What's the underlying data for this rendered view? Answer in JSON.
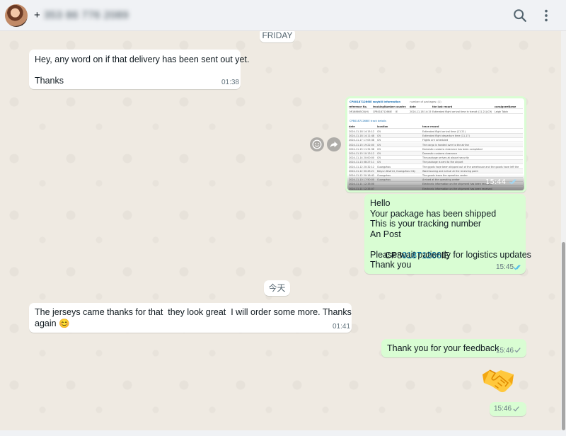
{
  "header": {
    "contact_prefix": "+",
    "contact_number": "353 86 776 2089",
    "search_icon": "search-icon",
    "menu_icon": "more-vertical-icon"
  },
  "messages": [
    {
      "kind": "date",
      "text": "FRIDAY"
    },
    {
      "kind": "incoming",
      "lines": [
        "Hey, any word on if that delivery has been sent out yet.",
        "",
        "Thanks"
      ],
      "time": "01:38"
    },
    {
      "kind": "outgoing-image",
      "time": "15:44",
      "image_text": {
        "title": "CP801871266IE waybill information",
        "count_label": "number of packages: (1)",
        "headers": [
          "reference No.",
          "trackingNumber",
          "country",
          "date",
          "the last record",
          "consigneeName"
        ],
        "row": [
          "OR168665CN(H)",
          "CP801871266IE",
          "IE",
          "2024-11-18 14:15",
          "Estimated flight arrival time in transit (11.21)(C9)",
          "Leigh Tobin"
        ],
        "section": "CP801871266IE track details",
        "track_headers": [
          "date",
          "location",
          "trace record"
        ],
        "track_rows": [
          [
            "2024-11-18 14:15:12",
            "CN",
            "Estimated flight arrival time (11.21)"
          ],
          [
            "2024-11-18 14:11:48",
            "CN",
            "Estimated flight departure time (11.17)"
          ],
          [
            "2024-11-17 17:05:38",
            "CN",
            "Flights are scheduled"
          ],
          [
            "2024-11-15 19:22:00",
            "CN",
            "The cargo is handed over to the airline"
          ],
          [
            "2024-11-15 11:31:38",
            "CN",
            "Domestic customs clearance has been completed"
          ],
          [
            "2024-11-15 10:13:12",
            "CN",
            "Domestic customs clearance"
          ],
          [
            "2024-11-14 20:00:00",
            "CN",
            "The package arrives at airport security"
          ],
          [
            "2024-11-13 08:27:11",
            "CN",
            "The package is sent to the airport"
          ],
          [
            "2024-11-12 20:32:12",
            "Guangzhou",
            "The goods have been shipped out of the warehouse and the goods have left the operation center"
          ],
          [
            "2024-11-12 00:43:21",
            "Baiyun District, Guangzhou City",
            "Warehousing and arrival at the receiving point"
          ],
          [
            "2024-11-12 20:16:42",
            "Guangzhou",
            "The goods leave the operation center"
          ],
          [
            "2024-11-10 17:50:00",
            "Guangzhou",
            "Arrived at the operating center"
          ],
          [
            "2024-11-11 12:33:00",
            "",
            "Electronic information on the shipment has been received"
          ],
          [
            "2024-11-11 12:33:07",
            "",
            "Electronic information on the shipment has been received"
          ]
        ]
      }
    },
    {
      "kind": "outgoing",
      "lines": [
        "Hello",
        "Your package has been shipped",
        "This is your tracking number",
        "An Post"
      ],
      "tracking_prefix": "CP8",
      "tracking_link": "01871266",
      "tracking_suffix": "IE",
      "lines_after": [
        "Please wait patiently for logistics updates",
        "Thank you"
      ],
      "time": "15:45"
    },
    {
      "kind": "date",
      "text": "今天"
    },
    {
      "kind": "incoming",
      "lines": [
        "The jerseys came thanks for that  they look great  I will order some more. Thanks",
        "again 😊"
      ],
      "time": "01:41"
    },
    {
      "kind": "outgoing",
      "lines": [
        "Thank you for your feedback"
      ],
      "time": "15:46"
    },
    {
      "kind": "outgoing-emoji",
      "emoji": "handshake-emoji",
      "time": "15:46"
    }
  ],
  "colors": {
    "incoming_bubble": "#ffffff",
    "outgoing_bubble": "#d9fdd3",
    "read_ticks": "#53bdeb",
    "sent_ticks": "#8696a0",
    "link": "#027eb5"
  }
}
